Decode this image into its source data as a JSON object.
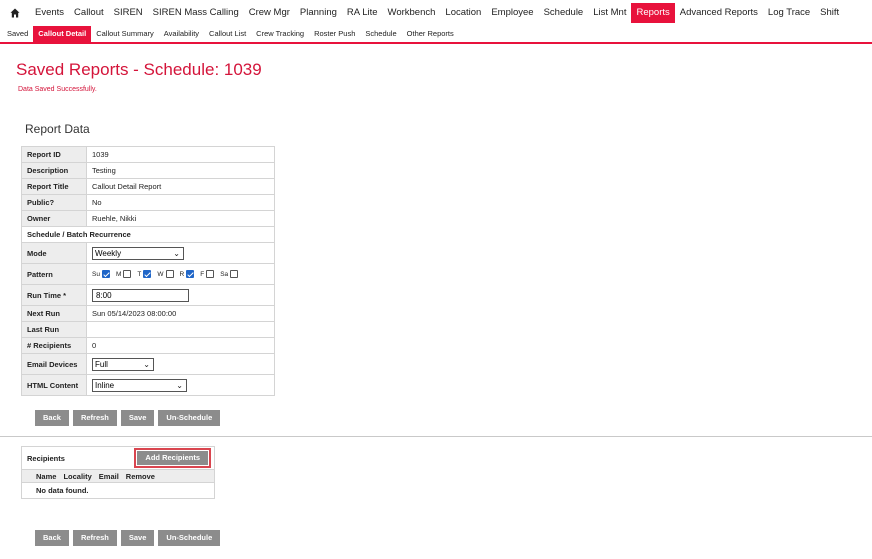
{
  "topnav": {
    "items": [
      "Events",
      "Callout",
      "SIREN",
      "SIREN Mass Calling",
      "Crew Mgr",
      "Planning",
      "RA Lite",
      "Workbench",
      "Location",
      "Employee",
      "Schedule",
      "List Mnt",
      "Reports",
      "Advanced Reports",
      "Log Trace",
      "Shift"
    ],
    "active": "Reports"
  },
  "subnav": {
    "items": [
      "Saved",
      "Callout Detail",
      "Callout Summary",
      "Availability",
      "Callout List",
      "Crew Tracking",
      "Roster Push",
      "Schedule",
      "Other Reports"
    ],
    "active": "Callout Detail"
  },
  "page_title": "Saved Reports - Schedule: 1039",
  "flash_message": "Data Saved Successfully.",
  "report_data": {
    "title": "Report Data",
    "report_id_label": "Report ID",
    "report_id": "1039",
    "description_label": "Description",
    "description": "Testing",
    "report_title_label": "Report Title",
    "report_title": "Callout Detail Report",
    "public_label": "Public?",
    "public": "No",
    "owner_label": "Owner",
    "owner": "Ruehle, Nikki",
    "schedule_header": "Schedule / Batch Recurrence",
    "mode_label": "Mode",
    "mode": "Weekly",
    "pattern_label": "Pattern",
    "pattern_days": [
      {
        "label": "Su",
        "checked": true
      },
      {
        "label": "M",
        "checked": false
      },
      {
        "label": "T",
        "checked": true
      },
      {
        "label": "W",
        "checked": false
      },
      {
        "label": "R",
        "checked": true
      },
      {
        "label": "F",
        "checked": false
      },
      {
        "label": "Sa",
        "checked": false
      }
    ],
    "run_time_label": "Run Time *",
    "run_time": "8:00",
    "next_run_label": "Next Run",
    "next_run": "Sun 05/14/2023 08:00:00",
    "last_run_label": "Last Run",
    "last_run": "",
    "recipients_count_label": "# Recipients",
    "recipients_count": "0",
    "email_devices_label": "Email Devices",
    "email_devices": "Full",
    "html_content_label": "HTML Content",
    "html_content": "Inline"
  },
  "buttons": {
    "back": "Back",
    "refresh": "Refresh",
    "save": "Save",
    "unschedule": "Un-Schedule"
  },
  "recipients": {
    "title": "Recipients",
    "add_button": "Add Recipients",
    "columns": [
      "Name",
      "Locality",
      "Email",
      "Remove"
    ],
    "empty_text": "No data found."
  }
}
